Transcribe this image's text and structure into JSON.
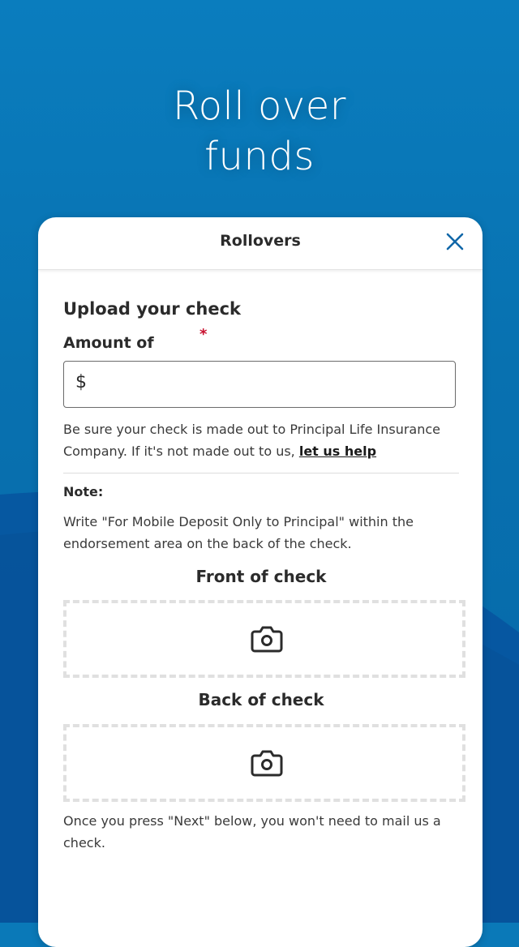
{
  "hero": {
    "title_line1": "Roll over",
    "title_line2": "funds"
  },
  "modal": {
    "title": "Rollovers",
    "close_icon": "close-icon"
  },
  "form": {
    "section_title": "Upload your check",
    "amount_label": "Amount of",
    "required_mark": "*",
    "currency_symbol": "$",
    "amount_value": "",
    "help_text_prefix": "Be sure your check is made out to Principal Life Insurance Company. If it's not made out to us, ",
    "help_link": "let us help",
    "note_label": "Note:",
    "note_text": "Write \"For Mobile Deposit Only to Principal\" within the endorsement area on the back of the check.",
    "front_title": "Front of check",
    "back_title": "Back of check",
    "camera_icon": "camera-icon",
    "footer_text": "Once you press \"Next\" below, you won't need to mail us a check."
  },
  "colors": {
    "background": "#0a79b8",
    "accent": "#1167a8",
    "required": "#c8102e"
  }
}
